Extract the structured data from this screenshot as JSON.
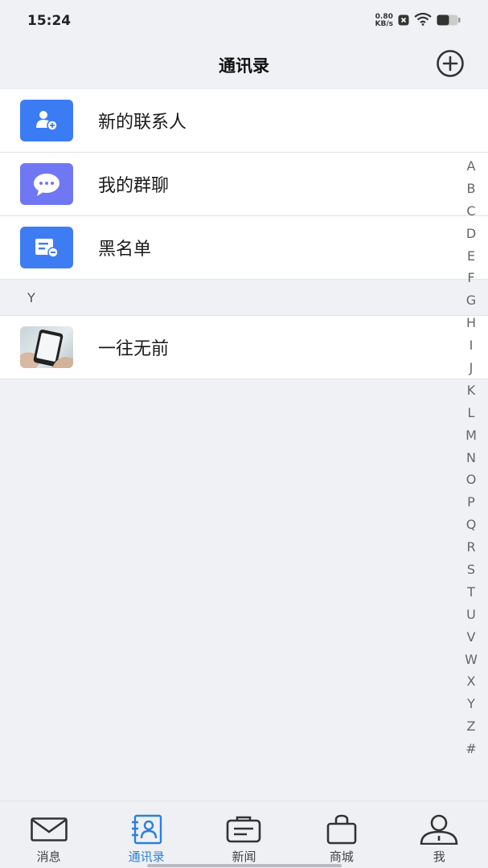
{
  "status_bar": {
    "time": "15:24",
    "net_speed_value": "0.80",
    "net_speed_unit": "KB/s",
    "icons": [
      "notification-x-icon",
      "wifi-icon",
      "battery-icon"
    ]
  },
  "header": {
    "title": "通讯录",
    "add_icon": "plus-circle-icon"
  },
  "list": {
    "rows": [
      {
        "label": "新的联系人",
        "icon": "add-contact-icon",
        "color": "#3b7cf5"
      },
      {
        "label": "我的群聊",
        "icon": "chat-bubble-icon",
        "color": "#6f78f2"
      },
      {
        "label": "黑名单",
        "icon": "blacklist-icon",
        "color": "#3e7cf4"
      }
    ],
    "section": "Y",
    "contacts": [
      {
        "name": "一往无前"
      }
    ]
  },
  "alpha_index": [
    "A",
    "B",
    "C",
    "D",
    "E",
    "F",
    "G",
    "H",
    "I",
    "J",
    "K",
    "L",
    "M",
    "N",
    "O",
    "P",
    "Q",
    "R",
    "S",
    "T",
    "U",
    "V",
    "W",
    "X",
    "Y",
    "Z",
    "#"
  ],
  "tabs": [
    {
      "label": "消息",
      "icon": "envelope-icon",
      "active": false
    },
    {
      "label": "通讯录",
      "icon": "contacts-icon",
      "active": true
    },
    {
      "label": "新闻",
      "icon": "news-icon",
      "active": false
    },
    {
      "label": "商城",
      "icon": "shopping-bag-icon",
      "active": false
    },
    {
      "label": "我",
      "icon": "person-icon",
      "active": false
    }
  ],
  "colors": {
    "accent": "#2d80d8",
    "background": "#eff1f5"
  }
}
